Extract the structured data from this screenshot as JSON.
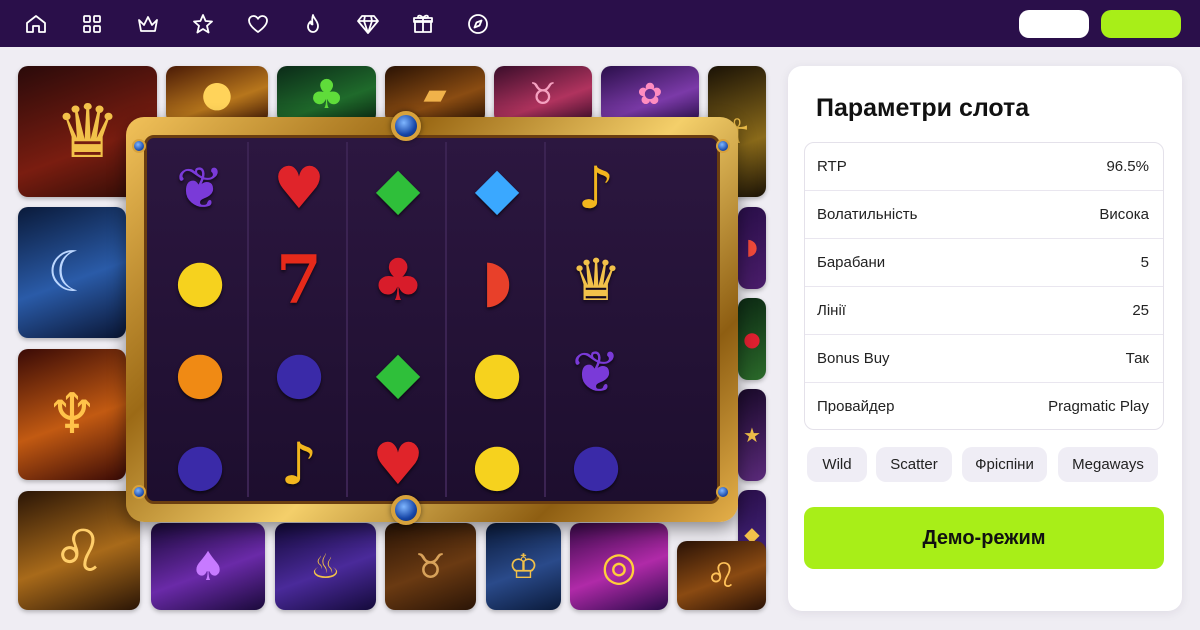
{
  "nav": {
    "icons": [
      "home-icon",
      "grid-icon",
      "crown-icon",
      "star-icon",
      "heart-icon",
      "flame-icon",
      "diamond-icon",
      "gift-icon",
      "compass-icon"
    ]
  },
  "colors": {
    "topbar": "#2a0f4a",
    "accent": "#a8ee18",
    "background": "#efedf3"
  },
  "panel": {
    "title": "Параметри слота",
    "params": [
      {
        "label": "RTP",
        "value": "96.5%"
      },
      {
        "label": "Волатильність",
        "value": "Висока"
      },
      {
        "label": "Барабани",
        "value": "5"
      },
      {
        "label": "Лінії",
        "value": "25"
      },
      {
        "label": "Bonus Buy",
        "value": "Так"
      },
      {
        "label": "Провайдер",
        "value": "Pragmatic Play"
      }
    ],
    "tags": [
      "Wild",
      "Scatter",
      "Фріспіни",
      "Megaways"
    ],
    "demo_button": "Демо-режим"
  },
  "slot": {
    "reels": [
      [
        "grape",
        "lemon",
        "orange",
        "plum"
      ],
      [
        "heart",
        "seven",
        "plum",
        "bell"
      ],
      [
        "emerald",
        "cherry",
        "emerald",
        "heart"
      ],
      [
        "diamond",
        "watermelon",
        "lemon",
        "lemon"
      ],
      [
        "bell",
        "crown",
        "grape",
        "plum"
      ]
    ]
  },
  "tiles": [
    "crown",
    "coins",
    "clover",
    "book",
    "buffalo",
    "lotus",
    "pharaoh",
    "wolf",
    "watermelon",
    "cherry",
    "dragon",
    "lion",
    "cat",
    "lamp",
    "bison",
    "king",
    "candy",
    "lion-roar"
  ]
}
